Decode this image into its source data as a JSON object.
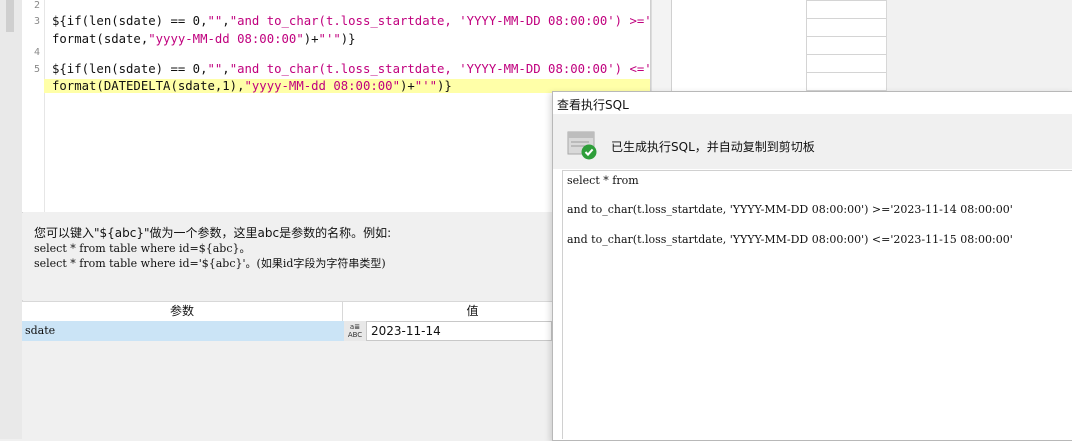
{
  "editor": {
    "line_numbers": [
      "2",
      "3",
      "4",
      "5"
    ],
    "line3_a": {
      "pre": "${if(len(sdate) == 0,",
      "s1": "\"\"",
      "mid": ",",
      "s2": "\"and to_char(t.loss_startdate, 'YYYY-MM-DD 08:00:00') >='\"",
      "post": "+"
    },
    "line3_b": {
      "pre": "format(sdate,",
      "s1": "\"yyyy-MM-dd 08:00:00\"",
      "mid": ")+",
      "s2": "\"'\"",
      "post": ")}"
    },
    "line5_a": {
      "pre": "${if(len(sdate) == 0,",
      "s1": "\"\"",
      "mid": ",",
      "s2": "\"and to_char(t.loss_startdate, 'YYYY-MM-DD 08:00:00') <='\"",
      "post": "+"
    },
    "line5_b": {
      "pre": "format(DATEDELTA(sdate,1),",
      "s1": "\"yyyy-MM-dd 08:00:00\"",
      "mid": ")+",
      "s2": "\"'\"",
      "post": ")}"
    }
  },
  "help": {
    "title": "您可以键入\"${abc}\"做为一个参数，这里abc是参数的名称。例如:",
    "example1": "select * from table where id=${abc}。",
    "example2": "select * from table where id='${abc}'。(如果id字段为字符串类型)"
  },
  "param_table": {
    "header_param": "参数",
    "header_value": "值",
    "row": {
      "name": "sdate",
      "type_icon_top": "a≣",
      "type_icon_bottom": "ABC",
      "value": "2023-11-14"
    }
  },
  "dialog": {
    "title": "查看执行SQL",
    "message": "已生成执行SQL，并自动复制到剪切板",
    "sql_lines": [
      "select * from",
      "and to_char(t.loss_startdate, 'YYYY-MM-DD 08:00:00') >='2023-11-14 08:00:00'",
      "and to_char(t.loss_startdate, 'YYYY-MM-DD 08:00:00') <='2023-11-15 08:00:00'"
    ]
  },
  "colors": {
    "string": "#c0007e",
    "highlight": "#ffffa8",
    "row_select": "#cbe4f6",
    "check": "#2e9e3a"
  },
  "icons": {
    "dialog_icon": "database-check-icon"
  }
}
